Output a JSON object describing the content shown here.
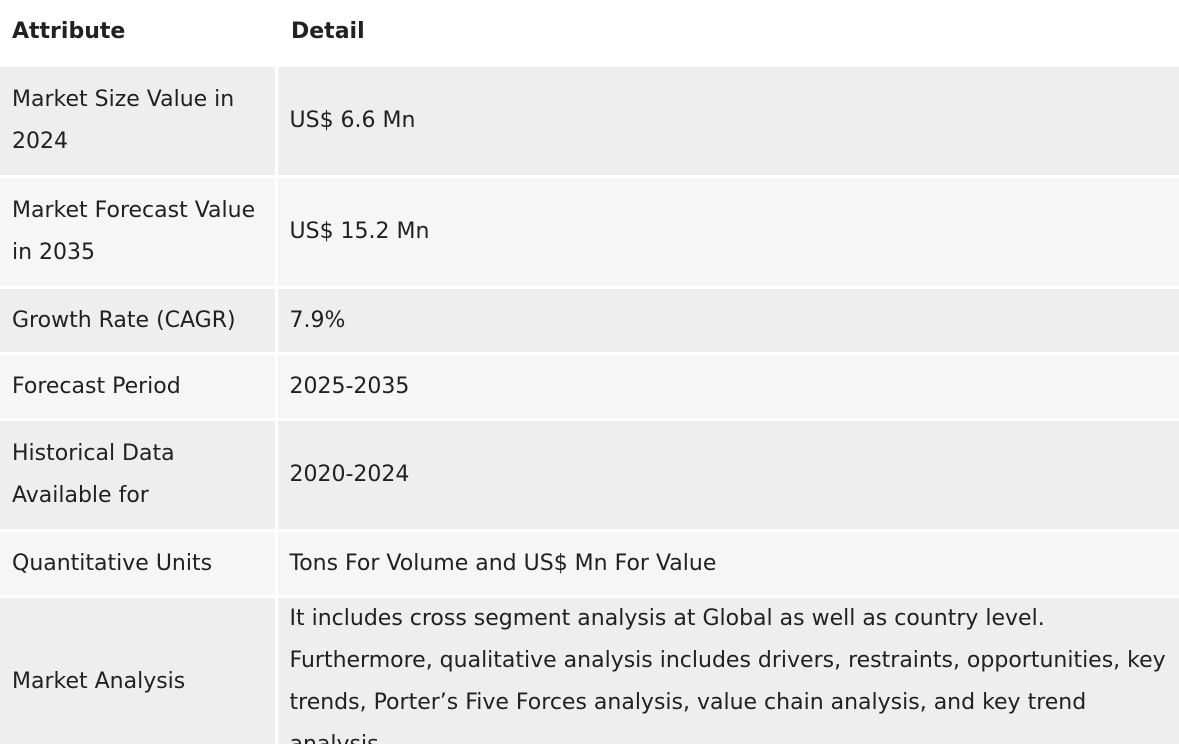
{
  "table": {
    "headers": {
      "attribute": "Attribute",
      "detail": "Detail"
    },
    "rows": [
      {
        "attribute": "Market Size Value in 2024",
        "detail": "US$ 6.6 Mn"
      },
      {
        "attribute": "Market Forecast Value in 2035",
        "detail": "US$ 15.2 Mn"
      },
      {
        "attribute": "Growth Rate (CAGR)",
        "detail": "7.9%"
      },
      {
        "attribute": "Forecast Period",
        "detail": "2025-2035"
      },
      {
        "attribute": "Historical Data Available for",
        "detail": "2020-2024"
      },
      {
        "attribute": "Quantitative Units",
        "detail": "Tons For Volume and US$ Mn For Value"
      },
      {
        "attribute": "Market Analysis",
        "detail": "It includes cross segment analysis at Global as well as country level. Furthermore, qualitative analysis includes drivers, restraints, opportunities, key trends, Porter’s Five Forces analysis, value chain analysis, and key trend analysis."
      }
    ]
  }
}
